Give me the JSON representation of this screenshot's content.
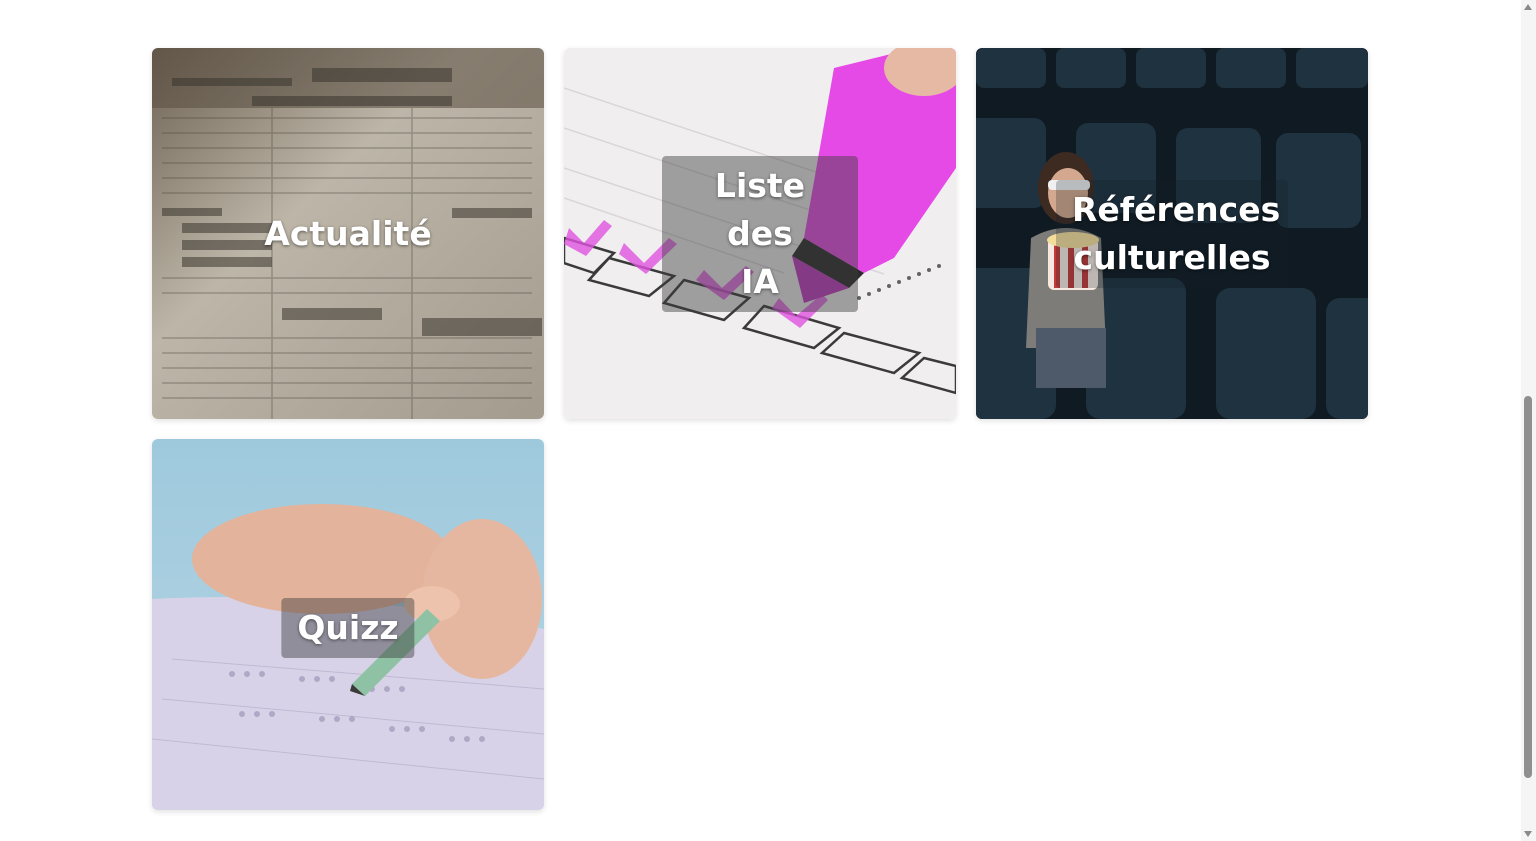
{
  "cards": [
    {
      "label": "Actualité",
      "image": "newspaper-image"
    },
    {
      "label": "Liste des\nIA",
      "image": "checklist-image"
    },
    {
      "label": "Références\nculturelles",
      "image": "cinema-image"
    },
    {
      "label": "Quizz",
      "image": "exam-image"
    }
  ]
}
